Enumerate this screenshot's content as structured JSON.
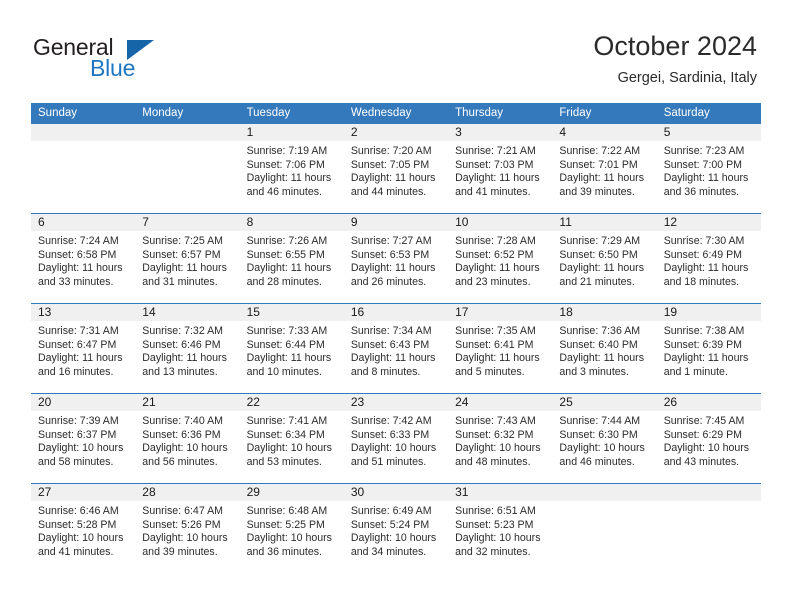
{
  "brand": {
    "word1": "General",
    "word2": "Blue",
    "triangle_color": "#1565a8",
    "blue_color": "#1f77c1"
  },
  "header": {
    "title": "October 2024",
    "subtitle": "Gergei, Sardinia, Italy"
  },
  "calendar": {
    "header_color": "#3479bb",
    "day_band_color": "#f0f0f0",
    "weekdays": [
      "Sunday",
      "Monday",
      "Tuesday",
      "Wednesday",
      "Thursday",
      "Friday",
      "Saturday"
    ],
    "weeks": [
      [
        {
          "day": "",
          "sunrise": "",
          "sunset": "",
          "daylight1": "",
          "daylight2": ""
        },
        {
          "day": "",
          "sunrise": "",
          "sunset": "",
          "daylight1": "",
          "daylight2": ""
        },
        {
          "day": "1",
          "sunrise": "Sunrise: 7:19 AM",
          "sunset": "Sunset: 7:06 PM",
          "daylight1": "Daylight: 11 hours",
          "daylight2": "and 46 minutes."
        },
        {
          "day": "2",
          "sunrise": "Sunrise: 7:20 AM",
          "sunset": "Sunset: 7:05 PM",
          "daylight1": "Daylight: 11 hours",
          "daylight2": "and 44 minutes."
        },
        {
          "day": "3",
          "sunrise": "Sunrise: 7:21 AM",
          "sunset": "Sunset: 7:03 PM",
          "daylight1": "Daylight: 11 hours",
          "daylight2": "and 41 minutes."
        },
        {
          "day": "4",
          "sunrise": "Sunrise: 7:22 AM",
          "sunset": "Sunset: 7:01 PM",
          "daylight1": "Daylight: 11 hours",
          "daylight2": "and 39 minutes."
        },
        {
          "day": "5",
          "sunrise": "Sunrise: 7:23 AM",
          "sunset": "Sunset: 7:00 PM",
          "daylight1": "Daylight: 11 hours",
          "daylight2": "and 36 minutes."
        }
      ],
      [
        {
          "day": "6",
          "sunrise": "Sunrise: 7:24 AM",
          "sunset": "Sunset: 6:58 PM",
          "daylight1": "Daylight: 11 hours",
          "daylight2": "and 33 minutes."
        },
        {
          "day": "7",
          "sunrise": "Sunrise: 7:25 AM",
          "sunset": "Sunset: 6:57 PM",
          "daylight1": "Daylight: 11 hours",
          "daylight2": "and 31 minutes."
        },
        {
          "day": "8",
          "sunrise": "Sunrise: 7:26 AM",
          "sunset": "Sunset: 6:55 PM",
          "daylight1": "Daylight: 11 hours",
          "daylight2": "and 28 minutes."
        },
        {
          "day": "9",
          "sunrise": "Sunrise: 7:27 AM",
          "sunset": "Sunset: 6:53 PM",
          "daylight1": "Daylight: 11 hours",
          "daylight2": "and 26 minutes."
        },
        {
          "day": "10",
          "sunrise": "Sunrise: 7:28 AM",
          "sunset": "Sunset: 6:52 PM",
          "daylight1": "Daylight: 11 hours",
          "daylight2": "and 23 minutes."
        },
        {
          "day": "11",
          "sunrise": "Sunrise: 7:29 AM",
          "sunset": "Sunset: 6:50 PM",
          "daylight1": "Daylight: 11 hours",
          "daylight2": "and 21 minutes."
        },
        {
          "day": "12",
          "sunrise": "Sunrise: 7:30 AM",
          "sunset": "Sunset: 6:49 PM",
          "daylight1": "Daylight: 11 hours",
          "daylight2": "and 18 minutes."
        }
      ],
      [
        {
          "day": "13",
          "sunrise": "Sunrise: 7:31 AM",
          "sunset": "Sunset: 6:47 PM",
          "daylight1": "Daylight: 11 hours",
          "daylight2": "and 16 minutes."
        },
        {
          "day": "14",
          "sunrise": "Sunrise: 7:32 AM",
          "sunset": "Sunset: 6:46 PM",
          "daylight1": "Daylight: 11 hours",
          "daylight2": "and 13 minutes."
        },
        {
          "day": "15",
          "sunrise": "Sunrise: 7:33 AM",
          "sunset": "Sunset: 6:44 PM",
          "daylight1": "Daylight: 11 hours",
          "daylight2": "and 10 minutes."
        },
        {
          "day": "16",
          "sunrise": "Sunrise: 7:34 AM",
          "sunset": "Sunset: 6:43 PM",
          "daylight1": "Daylight: 11 hours",
          "daylight2": "and 8 minutes."
        },
        {
          "day": "17",
          "sunrise": "Sunrise: 7:35 AM",
          "sunset": "Sunset: 6:41 PM",
          "daylight1": "Daylight: 11 hours",
          "daylight2": "and 5 minutes."
        },
        {
          "day": "18",
          "sunrise": "Sunrise: 7:36 AM",
          "sunset": "Sunset: 6:40 PM",
          "daylight1": "Daylight: 11 hours",
          "daylight2": "and 3 minutes."
        },
        {
          "day": "19",
          "sunrise": "Sunrise: 7:38 AM",
          "sunset": "Sunset: 6:39 PM",
          "daylight1": "Daylight: 11 hours",
          "daylight2": "and 1 minute."
        }
      ],
      [
        {
          "day": "20",
          "sunrise": "Sunrise: 7:39 AM",
          "sunset": "Sunset: 6:37 PM",
          "daylight1": "Daylight: 10 hours",
          "daylight2": "and 58 minutes."
        },
        {
          "day": "21",
          "sunrise": "Sunrise: 7:40 AM",
          "sunset": "Sunset: 6:36 PM",
          "daylight1": "Daylight: 10 hours",
          "daylight2": "and 56 minutes."
        },
        {
          "day": "22",
          "sunrise": "Sunrise: 7:41 AM",
          "sunset": "Sunset: 6:34 PM",
          "daylight1": "Daylight: 10 hours",
          "daylight2": "and 53 minutes."
        },
        {
          "day": "23",
          "sunrise": "Sunrise: 7:42 AM",
          "sunset": "Sunset: 6:33 PM",
          "daylight1": "Daylight: 10 hours",
          "daylight2": "and 51 minutes."
        },
        {
          "day": "24",
          "sunrise": "Sunrise: 7:43 AM",
          "sunset": "Sunset: 6:32 PM",
          "daylight1": "Daylight: 10 hours",
          "daylight2": "and 48 minutes."
        },
        {
          "day": "25",
          "sunrise": "Sunrise: 7:44 AM",
          "sunset": "Sunset: 6:30 PM",
          "daylight1": "Daylight: 10 hours",
          "daylight2": "and 46 minutes."
        },
        {
          "day": "26",
          "sunrise": "Sunrise: 7:45 AM",
          "sunset": "Sunset: 6:29 PM",
          "daylight1": "Daylight: 10 hours",
          "daylight2": "and 43 minutes."
        }
      ],
      [
        {
          "day": "27",
          "sunrise": "Sunrise: 6:46 AM",
          "sunset": "Sunset: 5:28 PM",
          "daylight1": "Daylight: 10 hours",
          "daylight2": "and 41 minutes."
        },
        {
          "day": "28",
          "sunrise": "Sunrise: 6:47 AM",
          "sunset": "Sunset: 5:26 PM",
          "daylight1": "Daylight: 10 hours",
          "daylight2": "and 39 minutes."
        },
        {
          "day": "29",
          "sunrise": "Sunrise: 6:48 AM",
          "sunset": "Sunset: 5:25 PM",
          "daylight1": "Daylight: 10 hours",
          "daylight2": "and 36 minutes."
        },
        {
          "day": "30",
          "sunrise": "Sunrise: 6:49 AM",
          "sunset": "Sunset: 5:24 PM",
          "daylight1": "Daylight: 10 hours",
          "daylight2": "and 34 minutes."
        },
        {
          "day": "31",
          "sunrise": "Sunrise: 6:51 AM",
          "sunset": "Sunset: 5:23 PM",
          "daylight1": "Daylight: 10 hours",
          "daylight2": "and 32 minutes."
        },
        {
          "day": "",
          "sunrise": "",
          "sunset": "",
          "daylight1": "",
          "daylight2": ""
        },
        {
          "day": "",
          "sunrise": "",
          "sunset": "",
          "daylight1": "",
          "daylight2": ""
        }
      ]
    ]
  }
}
